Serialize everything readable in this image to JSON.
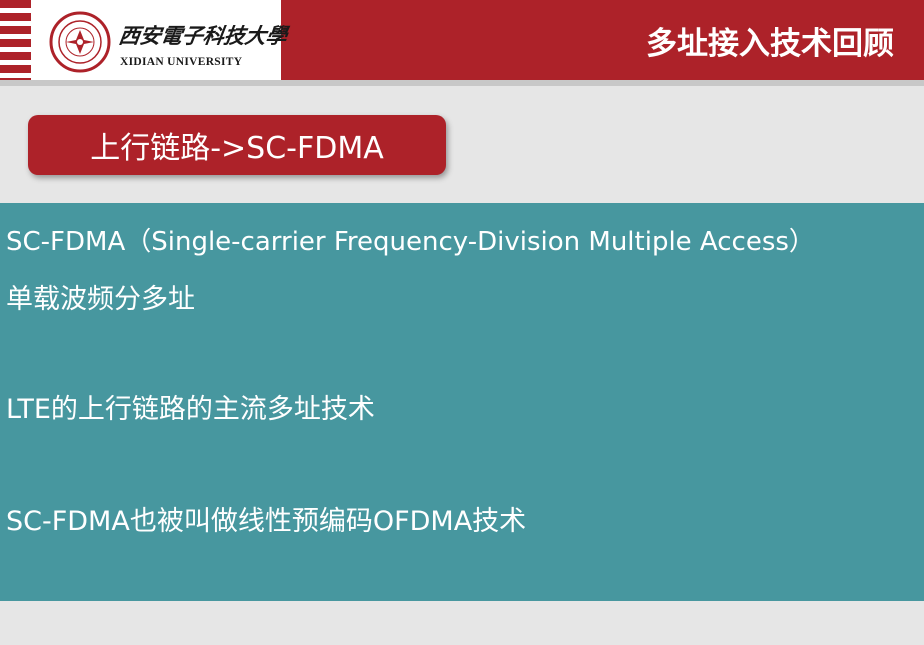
{
  "header": {
    "title": "多址接入技术回顾",
    "logo": {
      "name_cn": "西安電子科技大學",
      "name_en": "XIDIAN UNIVERSITY"
    }
  },
  "section": {
    "label": "上行链路->SC-FDMA"
  },
  "content": {
    "lines": [
      "SC-FDMA（Single-carrier Frequency-Division Multiple Access）",
      "单载波频分多址",
      "LTE的上行链路的主流多址技术",
      "SC-FDMA也被叫做线性预编码OFDMA技术"
    ]
  },
  "colors": {
    "brand_red": "#ad2229",
    "panel_teal": "#47979f",
    "background": "#e6e6e6"
  }
}
